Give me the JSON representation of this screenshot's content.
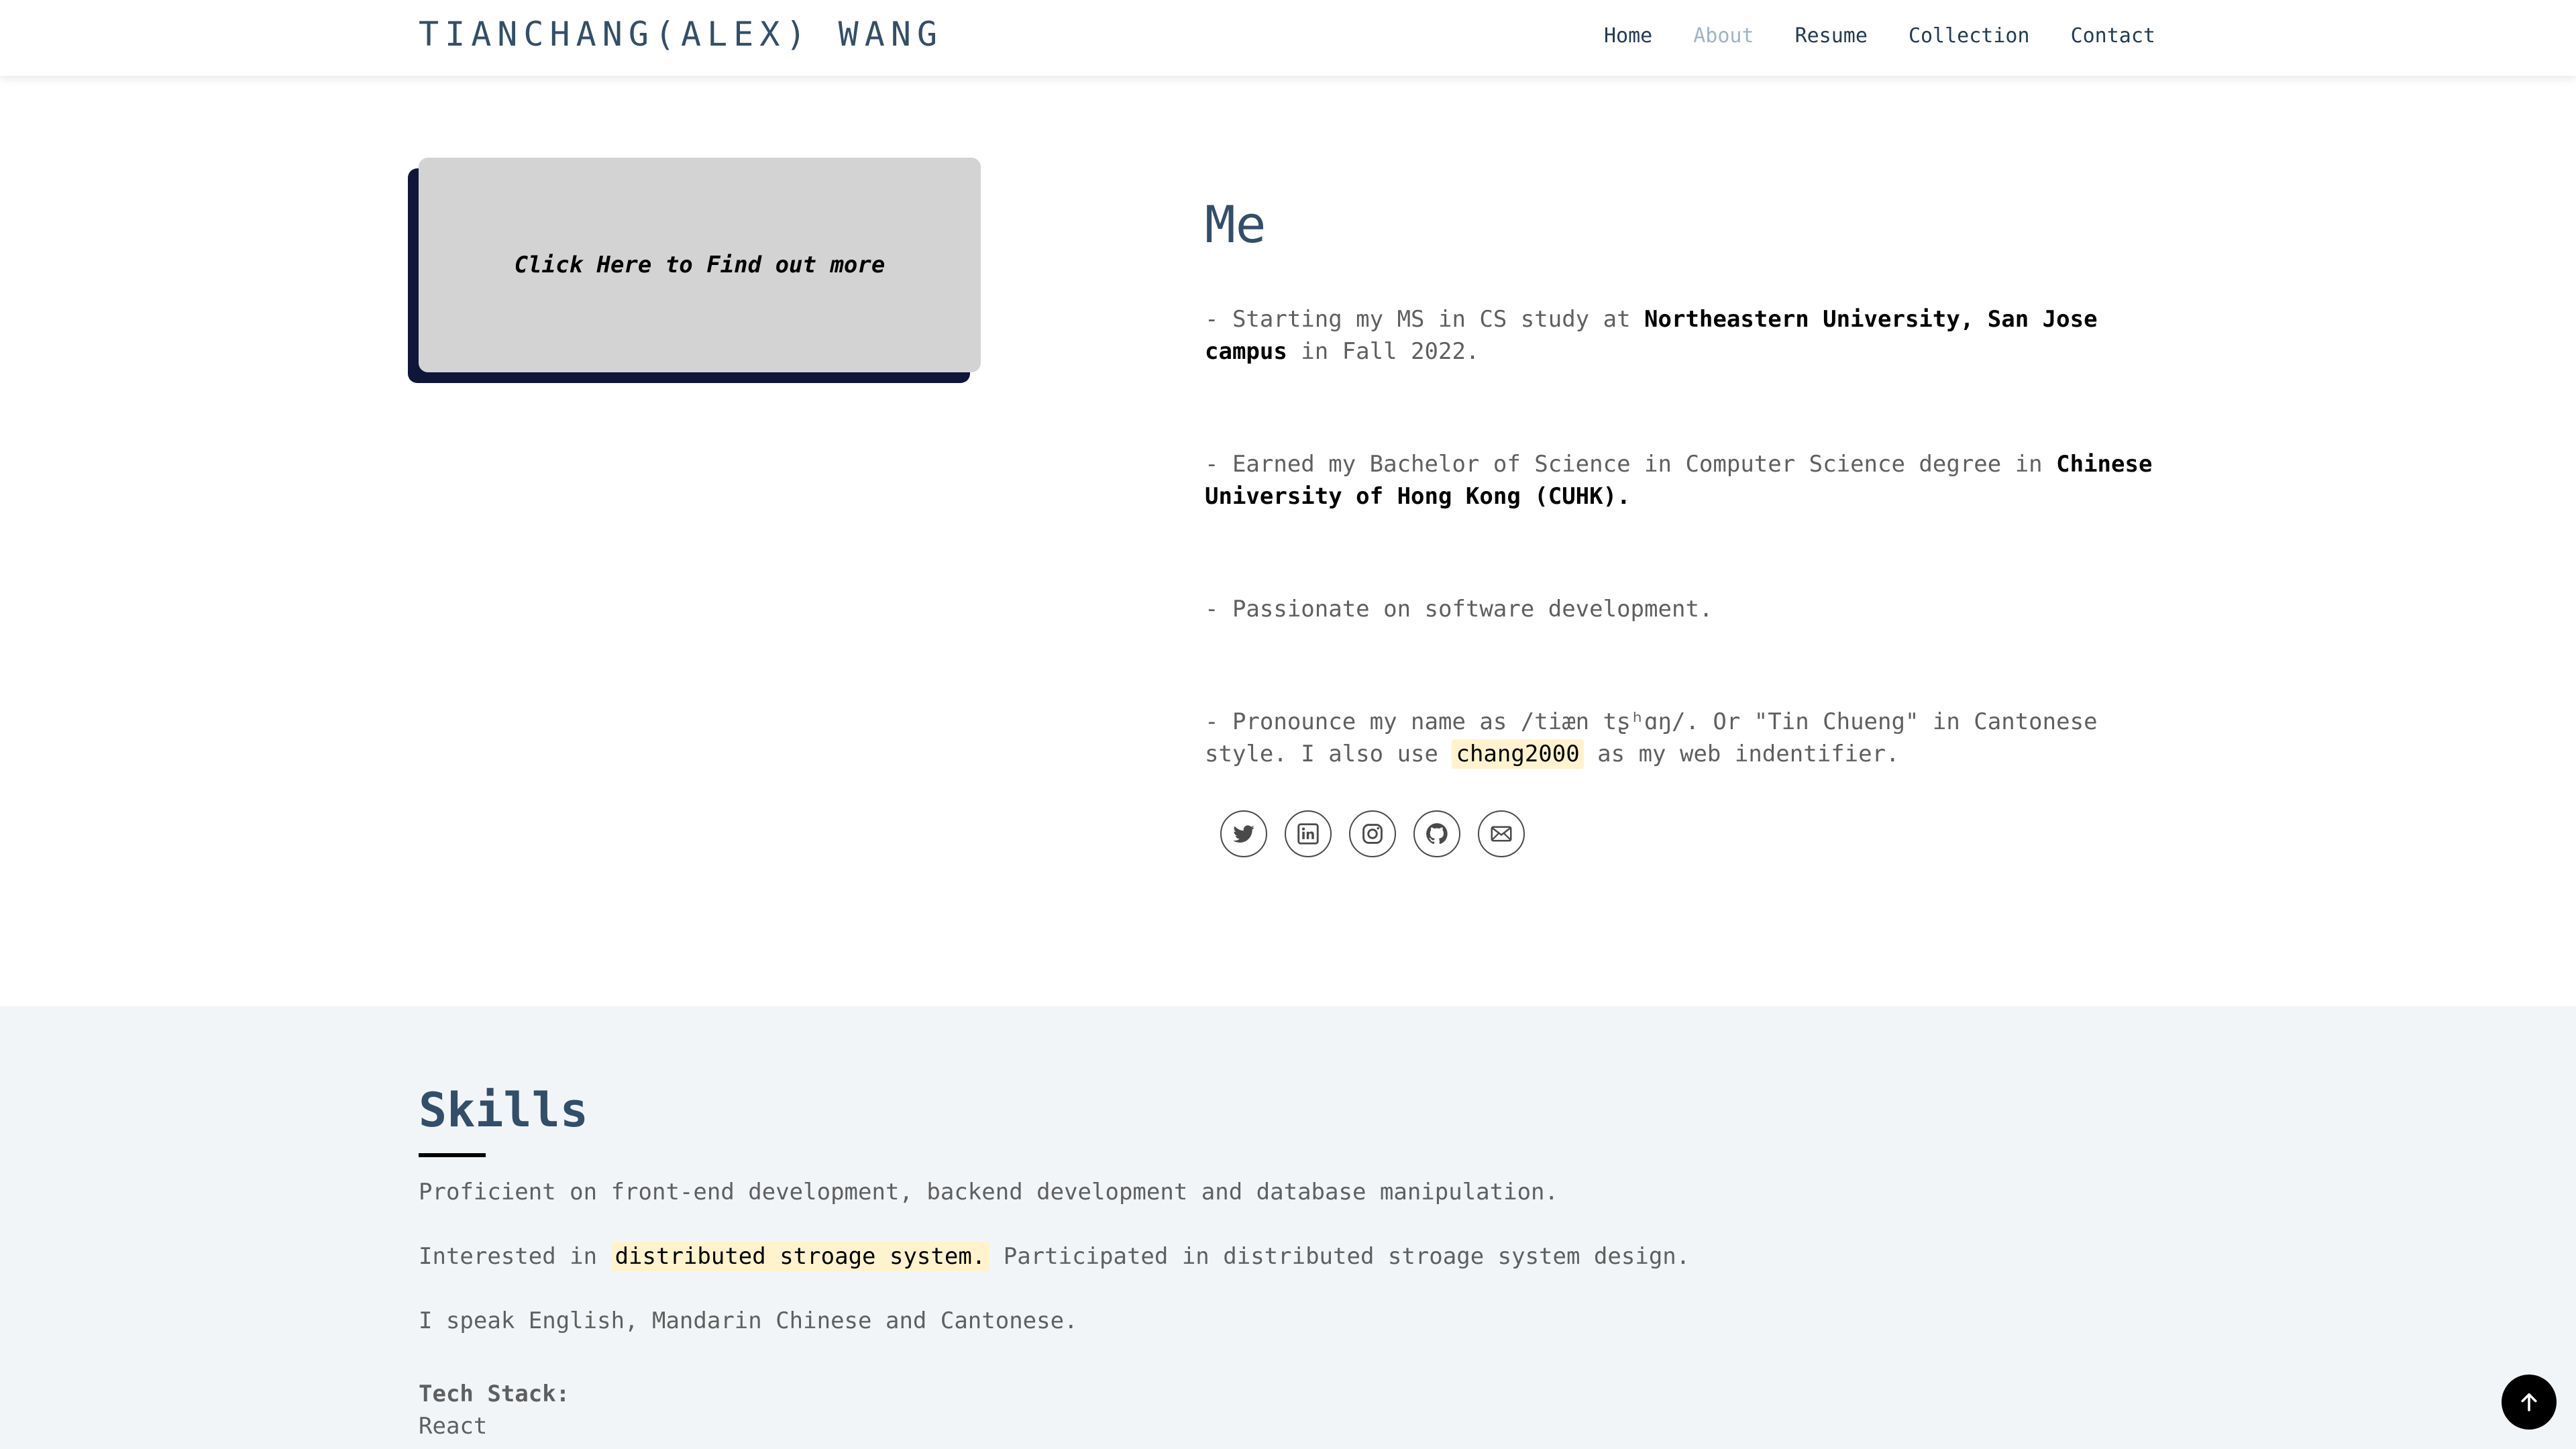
{
  "header": {
    "brand": "TIANCHANG(ALEX) WANG",
    "nav": [
      {
        "label": "Home"
      },
      {
        "label": "About",
        "active": true
      },
      {
        "label": "Resume"
      },
      {
        "label": "Collection"
      },
      {
        "label": "Contact"
      }
    ]
  },
  "about": {
    "card_label": "Click Here to Find out more",
    "title": "Me",
    "bio": [
      {
        "before": "- Starting my MS in CS study at ",
        "bold": "Northeastern University, San Jose campus",
        "after": " in Fall 2022."
      },
      {
        "before": "- Earned my Bachelor of Science in Computer Science degree in ",
        "bold": "Chinese University of Hong Kong (CUHK).",
        "after": ""
      },
      {
        "before": "- Passionate on software development.",
        "bold": "",
        "after": ""
      },
      {
        "before": "- Pronounce my name as /tiæn tʂʰɑŋ/. Or \"Tin Chueng\" in Cantonese style. I also use ",
        "highlight": "chang2000",
        "after": " as my web indentifier."
      }
    ],
    "socials": [
      "twitter-icon",
      "linkedin-icon",
      "instagram-icon",
      "github-icon",
      "mail-icon"
    ]
  },
  "skills": {
    "title": "Skills",
    "line1": "Proficient on front-end development, backend development and database manipulation.",
    "line2": {
      "before": "Interested in ",
      "highlight": "distributed stroage system.",
      "after": " Participated in distributed stroage system design."
    },
    "line3": "I speak English, Mandarin Chinese and Cantonese.",
    "tech_label": "Tech Stack:",
    "tech_items": [
      "React"
    ]
  },
  "colors": {
    "accent": "#334e68",
    "card_shadow": "#10153a",
    "card": "#d3d3d3",
    "highlight": "#fff3cd",
    "section_bg": "#f2f5f8"
  }
}
